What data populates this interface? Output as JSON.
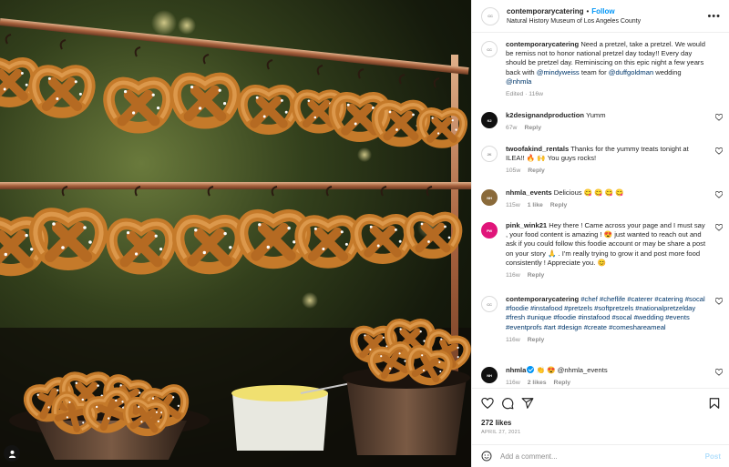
{
  "post": {
    "username": "contemporarycatering",
    "follow_label": "Follow",
    "separator": "•",
    "location": "Natural History Museum of Los Angeles County",
    "more_icon": "more-options-icon"
  },
  "caption": {
    "username": "contemporarycatering",
    "text_1": "Need a pretzel, take a pretzel. We would be remiss not to honor national pretzel day today!! Every day should be pretzel day. Reminiscing on this epic night a few years back with ",
    "mention_1": "@mindyweiss",
    "text_2": " team for ",
    "mention_2": "@duffgoldman",
    "text_3": " wedding ",
    "mention_3": "@nhmla",
    "meta": "Edited · 116w"
  },
  "comments": [
    {
      "username": "k2designandproduction",
      "text": "Yumm",
      "time": "67w",
      "likes": "",
      "reply": "Reply"
    },
    {
      "username": "twoofakind_rentals",
      "text": "Thanks for the yummy treats tonight at ILEA!! 🔥 🙌 You guys rocks!",
      "time": "105w",
      "likes": "",
      "reply": "Reply"
    },
    {
      "username": "nhmla_events",
      "text": "Delicious 😋 😋 😋 😋",
      "time": "115w",
      "likes": "1 like",
      "reply": "Reply"
    },
    {
      "username": "pink_wink21",
      "text": "Hey there ! Came across your page and I must say , your food content is amazing ! 😍 just wanted to reach out and ask if you could follow this foodie account or may be share a post on your story 🙏 . I'm really trying to grow it and post more food consistently ! Appreciate you. 😊",
      "time": "116w",
      "likes": "",
      "reply": "Reply"
    },
    {
      "username": "contemporarycatering",
      "text": "#chef #cheflife #caterer #catering #socal #foodie #instafood #pretzels #softpretzels #nationalpretzelday #fresh #unique #foodie #instafood #socal #wedding #events #eventprofs #art #design #create #comeshareameal",
      "time": "116w",
      "likes": "",
      "reply": "Reply"
    },
    {
      "username": "nhmla",
      "text": "👏 😍 @nhmla_events",
      "time": "116w",
      "likes": "2 likes",
      "reply": "Reply"
    }
  ],
  "actions": {
    "like_icon": "heart-icon",
    "comment_icon": "comment-icon",
    "share_icon": "send-icon",
    "save_icon": "bookmark-icon"
  },
  "likes": "272 likes",
  "date": "APRIL 27, 2021",
  "add_comment": {
    "placeholder": "Add a comment...",
    "post_label": "Post",
    "emoji_icon": "emoji-icon"
  },
  "colors": {
    "link": "#00376b",
    "accent": "#0095f6",
    "muted": "#8e8e8e",
    "post_disabled": "#b2dffc"
  }
}
